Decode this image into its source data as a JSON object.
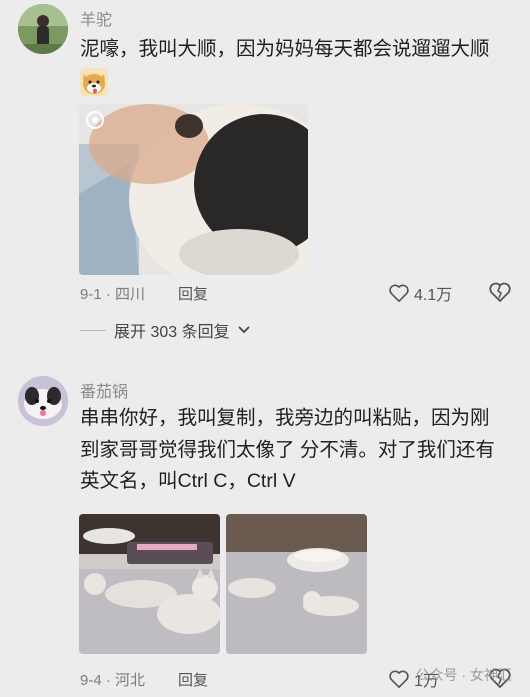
{
  "comments": [
    {
      "username": "羊驼",
      "text": "泥嚎，我叫大顺，因为妈妈每天都会说遛遛大顺",
      "emoji_icon": "dog-face-emoji",
      "location": "9-1 · 四川",
      "reply_label": "回复",
      "likes": "4.1万",
      "expand_label": "展开 303 条回复"
    },
    {
      "username": "番茄锅",
      "text_lines": [
        "串串你好，我叫复制，我旁边的叫粘贴，因为刚",
        "到家哥哥觉得我们太像了 分不清。对了我们还有",
        "英文名，叫Ctrl C，Ctrl V"
      ],
      "location": "9-4 · 河北",
      "reply_label": "回复",
      "likes": "1万"
    }
  ],
  "watermark": "公众号 · 女神汇",
  "colors": {
    "background": "#ececec",
    "username": "#8a8a8a",
    "meta": "#7d7d7d"
  }
}
